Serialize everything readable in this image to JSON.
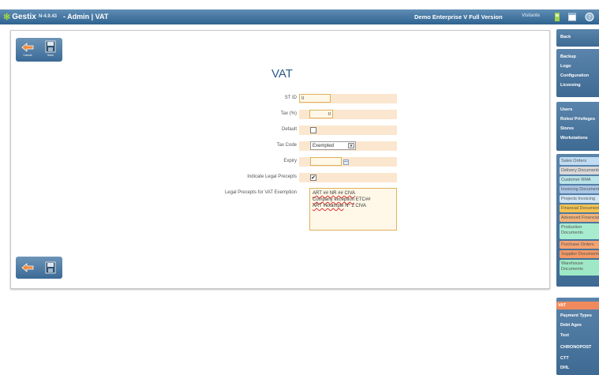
{
  "app": {
    "name": "Gestix",
    "version": "N-4.9.43",
    "title": "- Admin | VAT",
    "edition": "Demo Enterprise V Full Version",
    "visitors_label": "Visitante"
  },
  "toolbar": {
    "cancel_label": "Cancel",
    "save_label": "Save"
  },
  "page_title": "VAT",
  "form": {
    "stid": {
      "label": "ST ID",
      "value": "0"
    },
    "tax": {
      "label": "Tax (%)",
      "value": "0"
    },
    "default": {
      "label": "Default",
      "checked": false
    },
    "tax_code": {
      "label": "Tax Code",
      "value": "Exempted"
    },
    "expiry": {
      "label": "Expiry",
      "value": ""
    },
    "legal_precepts": {
      "label": "Indicate Legal Precepts",
      "checked": true
    },
    "exemption": {
      "label": "Legal Precepts for VAT Exemption",
      "line1_a": "ART ## NR ## CIVA",
      "line2_a": "Company exception",
      "line2_b": " ETC##",
      "line3_a": "ART #example",
      "line3_b": " Nº 2 CIVA"
    }
  },
  "sidebar": {
    "back": "Back",
    "system": [
      "Backup",
      "Logo",
      "Configuration",
      "Licensing"
    ],
    "users": [
      "Users",
      "Roles/ Privileges",
      "Stores",
      "Workstations"
    ],
    "docs": [
      {
        "label": "Sales Orders",
        "color": "#bfdcf3"
      },
      {
        "label": "Delivery Documents",
        "color": "#d9d9d9"
      },
      {
        "label": "Customer RMA",
        "color": "#b8e3e8"
      },
      {
        "label": "Invoicing Documents",
        "color": "#a9c6e6"
      },
      {
        "label": "Projects Invoicing",
        "color": "#cfe6f7"
      },
      {
        "label": "Financial Documents",
        "color": "#f6c451"
      },
      {
        "label": "Advanced Financial",
        "color": "#f4b57a"
      },
      {
        "label": "Production Documents",
        "color": "#a8ecd0"
      },
      {
        "label": "Purchase Orders",
        "color": "#f4a373"
      },
      {
        "label": "Supplier Documents",
        "color": "#f59a66"
      },
      {
        "label": "Warehouse Documents",
        "color": "#9fe8c5"
      }
    ],
    "bottom_active": "VAT",
    "bottom": [
      "Payment Types",
      "Debt Ages",
      "Text",
      "CHRONOPOST",
      "CTT",
      "DHL"
    ]
  }
}
